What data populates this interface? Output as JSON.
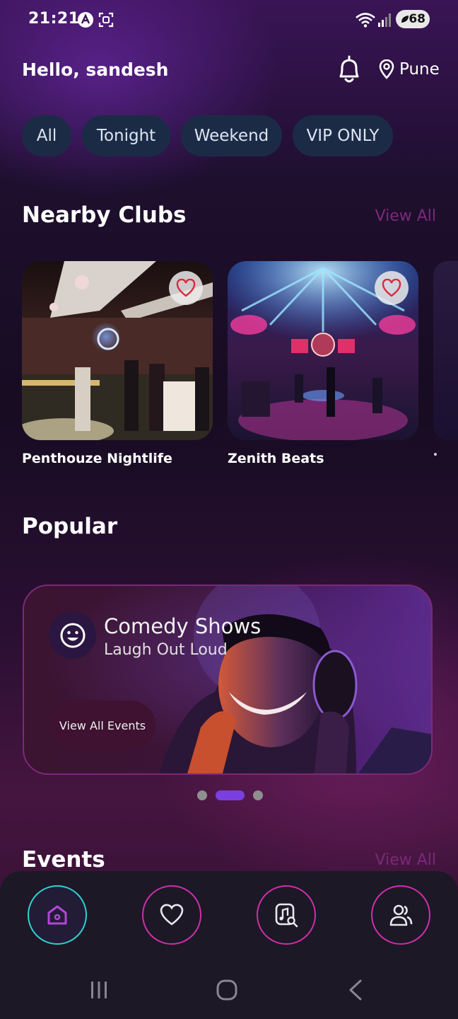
{
  "status_bar": {
    "time": "21:21",
    "battery": "68"
  },
  "header": {
    "greeting": "Hello, sandesh",
    "location": "Pune"
  },
  "filters": [
    "All",
    "Tonight",
    "Weekend",
    "VIP ONLY"
  ],
  "nearby": {
    "title": "Nearby Clubs",
    "view_all": "View All",
    "clubs": [
      {
        "name": "Penthouze Nightlife"
      },
      {
        "name": "Zenith Beats"
      }
    ]
  },
  "popular": {
    "title": "Popular",
    "banner": {
      "title": "Comedy Shows",
      "subtitle": "Laugh Out Loud",
      "button": "View All Events"
    },
    "carousel": {
      "count": 3,
      "active_index": 1
    }
  },
  "events": {
    "title": "Events",
    "view_all": "View All"
  },
  "bottom_nav": {
    "items": [
      {
        "icon": "home-icon",
        "active": true
      },
      {
        "icon": "heart-icon",
        "active": false
      },
      {
        "icon": "music-search-icon",
        "active": false
      },
      {
        "icon": "users-icon",
        "active": false
      }
    ]
  },
  "colors": {
    "accent_purple": "#7a3fe0",
    "nav_border": "#d02ea8",
    "nav_active_border": "#2fd2cf",
    "chip_bg": "#1c2b45",
    "view_all": "#7a2a78"
  }
}
